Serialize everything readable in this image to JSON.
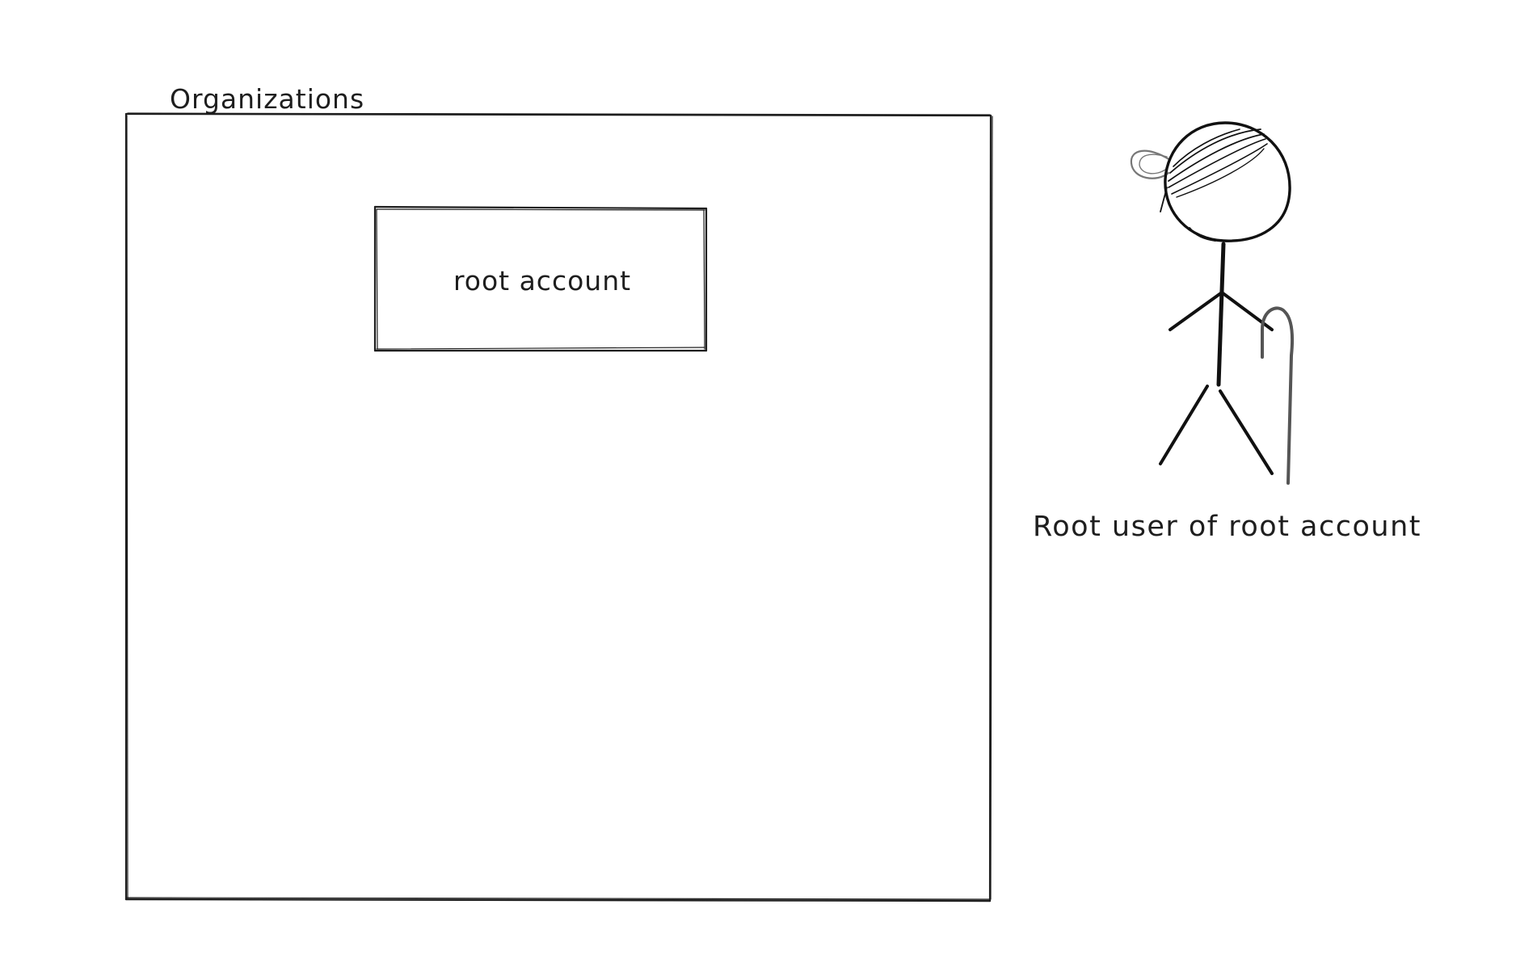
{
  "diagram": {
    "container": {
      "label": "Organizations"
    },
    "account_box": {
      "label": "root account"
    },
    "actor": {
      "label": "Root user of root account",
      "icon": "stick-figure-with-cane-icon"
    },
    "colors": {
      "stroke": "#1e1e1e",
      "cane": "#555555",
      "background": "#ffffff"
    }
  }
}
